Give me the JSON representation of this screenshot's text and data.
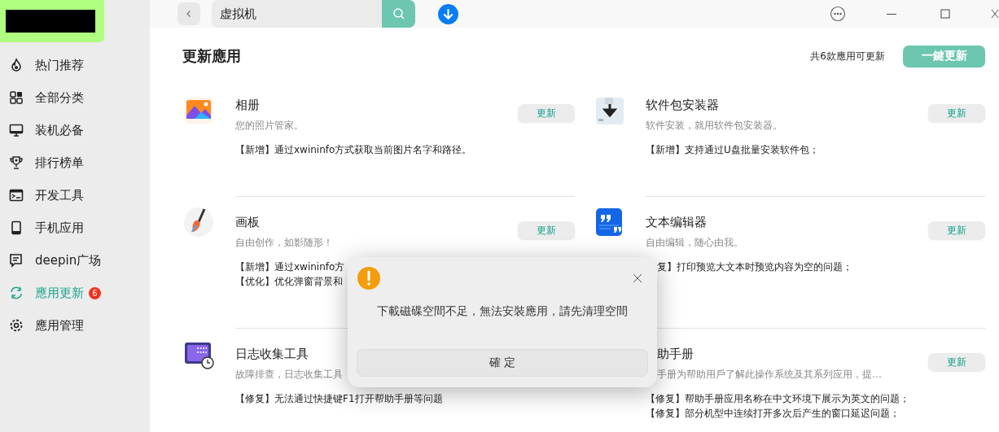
{
  "search": {
    "value": "虚拟机"
  },
  "sidebar": {
    "items": [
      {
        "label": "热门推荐",
        "selected": false
      },
      {
        "label": "全部分类",
        "selected": false
      },
      {
        "label": "装机必备",
        "selected": false
      },
      {
        "label": "排行榜单",
        "selected": false
      },
      {
        "label": "开发工具",
        "selected": false
      },
      {
        "label": "手机应用",
        "selected": false
      },
      {
        "label": "deepin广场",
        "selected": false
      },
      {
        "label": "應用更新",
        "selected": true,
        "badge": "6"
      },
      {
        "label": "應用管理",
        "selected": false
      }
    ]
  },
  "page": {
    "title": "更新應用",
    "summary": "共6款應用可更新",
    "update_all_button": "一鍵更新"
  },
  "updates": [
    {
      "name": "相册",
      "description": "您的照片管家。",
      "notes": [
        {
          "text": "【新增】通过xwininfo方式获取当前图片名字和路径。",
          "cut": false
        }
      ],
      "button": "更新",
      "name_cut": false,
      "description_cut": false
    },
    {
      "name": "软件包安装器",
      "description": "软件安装，就用软件包安装器。",
      "notes": [
        {
          "text": "【新增】支持通过U盘批量安装软件包；",
          "cut": false
        }
      ],
      "button": "更新",
      "name_cut": false,
      "description_cut": false
    },
    {
      "name": "画板",
      "description": "自由创作，如影随形！",
      "notes": [
        {
          "text": "【新增】通过xwininfo方",
          "cut": false
        },
        {
          "text": "【优化】优化弹窗背景和",
          "cut": false
        }
      ],
      "button": "更新",
      "name_cut": false,
      "description_cut": false
    },
    {
      "name": "文本编辑器",
      "description": "自由编辑，随心由我。",
      "notes": [
        {
          "text": "复】打印预览大文本时预览内容为空的问题；",
          "cut": true
        }
      ],
      "button": "更新",
      "name_cut": false,
      "description_cut": false
    },
    {
      "name": "日志收集工具",
      "description": "故障排查，日志收集工具",
      "notes": [
        {
          "text": "【修复】无法通过快捷键F1打开帮助手册等问题",
          "cut": false
        }
      ],
      "name_cut": false,
      "description_cut": false
    },
    {
      "name": "助手册",
      "description": "手册为帮助用戶了解此操作系统及其系列应用，提…",
      "notes": [
        {
          "text": "【修复】帮助手册应用名称在中文环境下展示为英文的问题；",
          "cut": false
        },
        {
          "text": "【修复】部分机型中连续打开多次后产生的窗口延迟问题；",
          "cut": false
        }
      ],
      "button": "更新",
      "name_cut": true,
      "description_cut": true
    }
  ],
  "dialog": {
    "message": "下載磁碟空間不足，無法安裝應用，請先清理空間",
    "button": "確 定"
  }
}
